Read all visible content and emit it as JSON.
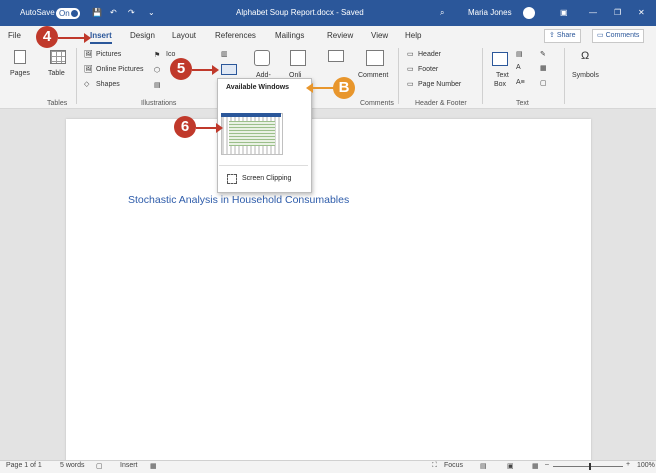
{
  "titlebar": {
    "autosave_label": "AutoSave",
    "autosave_state": "On",
    "doc_title": "Alphabet Soup Report.docx - Saved",
    "user_name": "Maria Jones"
  },
  "tabs": [
    "File",
    "Insert",
    "Design",
    "Layout",
    "References",
    "Mailings",
    "Review",
    "View",
    "Help"
  ],
  "active_tab": "Insert",
  "actions": {
    "share": "Share",
    "comments": "Comments"
  },
  "ribbon": {
    "pages": "Pages",
    "table": "Table",
    "pictures": "Pictures",
    "online_pictures": "Online Pictures",
    "shapes": "Shapes",
    "icons": "Ico",
    "add_ins": "Add-",
    "online_video": "Onli",
    "comment": "Comment",
    "header": "Header",
    "footer": "Footer",
    "page_number": "Page Number",
    "text_box_1": "Text",
    "text_box_2": "Box",
    "symbols": "Symbols",
    "groups": {
      "tables": "Tables",
      "illustrations": "Illustrations",
      "comments": "Comments",
      "header_footer": "Header & Footer",
      "text": "Text"
    }
  },
  "dropdown": {
    "heading": "Available Windows",
    "screen_clipping": "Screen Clipping"
  },
  "callouts": {
    "c4": "4",
    "c5": "5",
    "c6": "6",
    "cB": "B"
  },
  "document": {
    "text": "Stochastic Analysis in Household Consumables"
  },
  "statusbar": {
    "page": "Page 1 of 1",
    "words": "5 words",
    "mode": "Insert",
    "focus": "Focus",
    "zoom": "100%"
  },
  "colors": {
    "titlebar": "#2b579a",
    "callout_red": "#c0392b",
    "callout_orange": "#e8962c",
    "doc_text": "#2e5caa"
  }
}
